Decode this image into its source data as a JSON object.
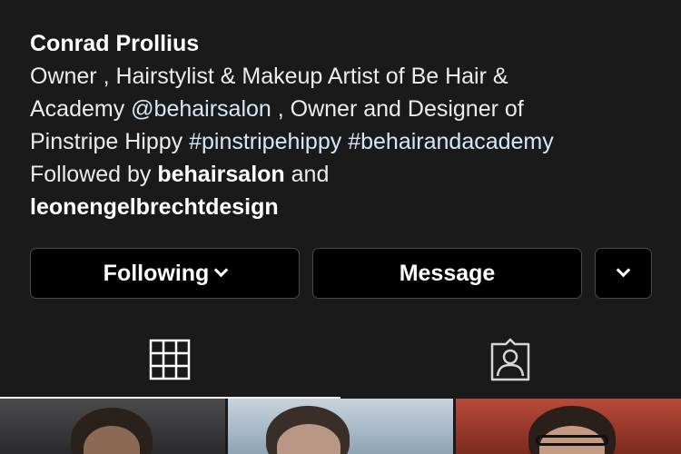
{
  "profile": {
    "name": "Conrad Prollius",
    "bio_line1": "Owner , Hairstylist & Makeup Artist of Be Hair &",
    "bio_line2_prefix": "Academy ",
    "bio_link": "@behairsalon",
    "bio_line2_suffix": " , Owner and Designer of",
    "bio_line3_prefix": "Pinstripe Hippy ",
    "hashtag1": "#pinstripehippy",
    "bio_space": " ",
    "hashtag2": "#behairandacademy",
    "followed_by_prefix": "Followed by ",
    "followed_by_user1": "behairsalon",
    "followed_by_and": " and",
    "followed_by_user2": "leonengelbrechtdesign"
  },
  "actions": {
    "following_label": "Following",
    "message_label": "Message"
  },
  "tabs": {
    "grid_icon": "grid-icon",
    "tagged_icon": "tagged-person-icon"
  },
  "colors": {
    "background": "#1a1a1a",
    "button_bg": "#000000",
    "link": "#d8e6f5"
  }
}
